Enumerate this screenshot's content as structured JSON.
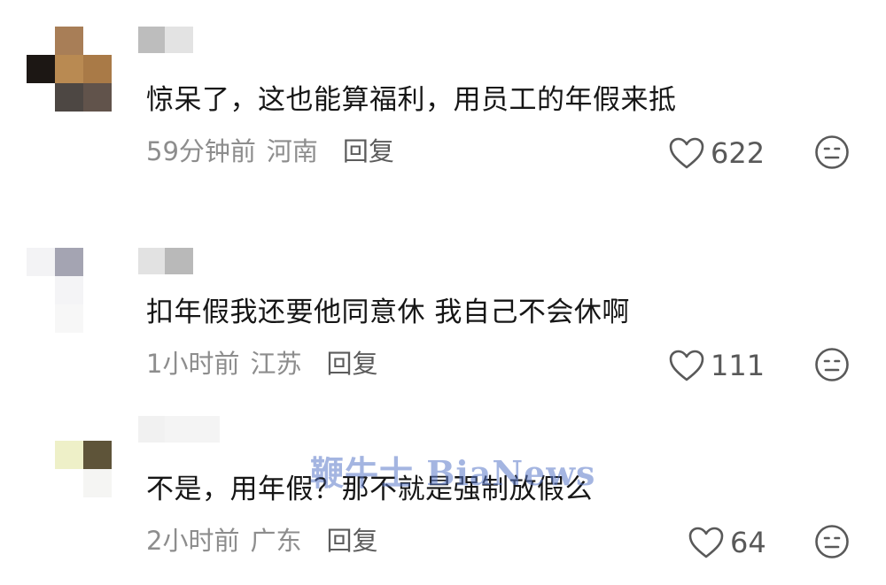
{
  "comments": [
    {
      "text": "惊呆了，这也能算福利，用员工的年假来抵",
      "time": "59分钟前",
      "location": "河南",
      "reply_label": "回复",
      "likes": "622"
    },
    {
      "text": "扣年假我还要他同意休 我自己不会休啊",
      "time": "1小时前",
      "location": "江苏",
      "reply_label": "回复",
      "likes": "111"
    },
    {
      "text": "不是，用年假？那不就是强制放假么",
      "time": "2小时前",
      "location": "广东",
      "reply_label": "回复",
      "likes": "64"
    }
  ],
  "watermark": "鞭牛士 BiaNews",
  "icons": {
    "like": "heart-outline-icon",
    "react": "neutral-face-icon"
  },
  "colors": {
    "text": "#161616",
    "meta": "#8d8d8d",
    "reply": "#5c5c5c",
    "icon": "#595959"
  }
}
